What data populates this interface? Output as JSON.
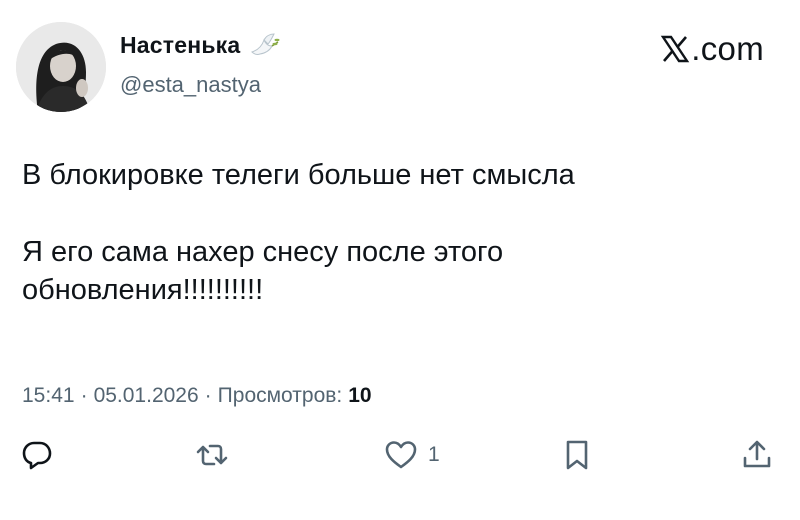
{
  "author": {
    "display_name": "Настенька",
    "handle": "@esta_nastya"
  },
  "brand": {
    "label": ".com"
  },
  "tweet": {
    "paragraphs": [
      "В блокировке телеги больше нет смысла",
      "Я его сама нахер снесу после этого обновления!!!!!!!!!!"
    ]
  },
  "meta": {
    "time": "15:41",
    "separator": "·",
    "date": "05.01.2026",
    "views_label": "Просмотров:",
    "views_count": "10"
  },
  "actions": {
    "like_count": "1"
  },
  "icons": {
    "avatar": "profile-photo",
    "dove": "dove-with-olive-branch-icon",
    "brand": "x-logo-icon",
    "reply": "reply-icon",
    "repost": "repost-icon",
    "like": "heart-icon",
    "bookmark": "bookmark-icon",
    "share": "share-icon"
  },
  "colors": {
    "text": "#0f1419",
    "secondary": "#536471",
    "background": "#ffffff"
  }
}
